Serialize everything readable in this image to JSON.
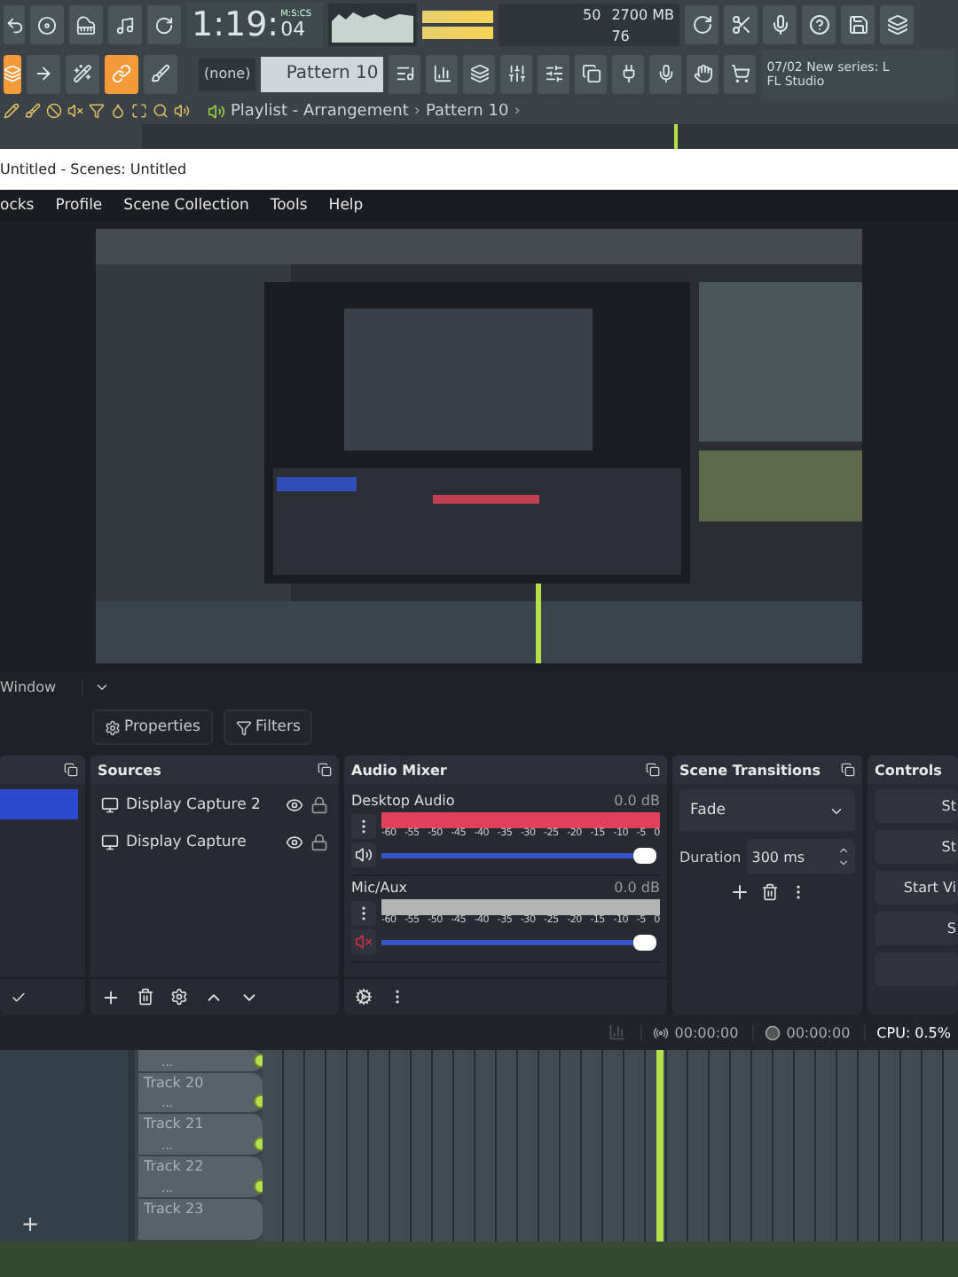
{
  "fl_toolbar": {
    "time": "1:19:",
    "time_small": "04",
    "time_unit": "M:S:CS",
    "cpu_value": "50",
    "memory": "2700 MB",
    "polyphony": "76",
    "pattern_selector": "(none)",
    "pattern": "Pattern 10",
    "news_line1": "07/02  New series: L",
    "news_line2": "FL Studio"
  },
  "fl_breadcrumb": [
    {
      "label": "Playlist - Arrangement",
      "separator": "›"
    },
    {
      "label": "Pattern 10",
      "separator": "›"
    }
  ],
  "obs": {
    "title": "Untitled - Scenes: Untitled",
    "menu": [
      "ocks",
      "Profile",
      "Scene Collection",
      "Tools",
      "Help"
    ],
    "context_label": "Window",
    "context_buttons": [
      "Properties",
      "Filters"
    ],
    "scenes": {
      "items": [
        {
          "selected": true
        }
      ]
    },
    "sources": {
      "title": "Sources",
      "items": [
        {
          "name": "Display Capture 2"
        },
        {
          "name": "Display Capture"
        }
      ]
    },
    "audio_mixer": {
      "title": "Audio Mixer",
      "channels": [
        {
          "name": "Desktop Audio",
          "reading": "0.0 dB",
          "muted": false,
          "level": 1,
          "color": "#e0405a",
          "scale": [
            "-60",
            "-55",
            "-50",
            "-45",
            "-40",
            "-35",
            "-30",
            "-25",
            "-20",
            "-15",
            "-10",
            "-5",
            "0"
          ]
        },
        {
          "name": "Mic/Aux",
          "reading": "0.0 dB",
          "muted": true,
          "level": 1,
          "color": "#b4b4b4",
          "scale": [
            "-60",
            "-55",
            "-50",
            "-45",
            "-40",
            "-35",
            "-30",
            "-25",
            "-20",
            "-15",
            "-10",
            "-5",
            "0"
          ]
        }
      ]
    },
    "scene_transitions": {
      "title": "Scene Transitions",
      "transition": "Fade",
      "duration_label": "Duration",
      "duration": "300 ms"
    },
    "controls": {
      "title": "Controls",
      "buttons": [
        {
          "kind": "text",
          "label": "St"
        },
        {
          "kind": "text",
          "label": "St"
        },
        {
          "kind": "text",
          "label": "Start Vi"
        },
        {
          "kind": "text",
          "label": "S"
        },
        {
          "kind": "blank"
        }
      ]
    },
    "status_bar": {
      "stream_time": "00:00:00",
      "record_time": "00:00:00",
      "cpu": "CPU: 0.5%"
    }
  },
  "playlist": {
    "tracks": [
      {
        "menu": "..."
      },
      {
        "name": "Track 20",
        "menu": "..."
      },
      {
        "name": "Track 21",
        "menu": "..."
      },
      {
        "name": "Track 22",
        "menu": "..."
      },
      {
        "name": "Track 23"
      }
    ],
    "add_button": "+"
  }
}
